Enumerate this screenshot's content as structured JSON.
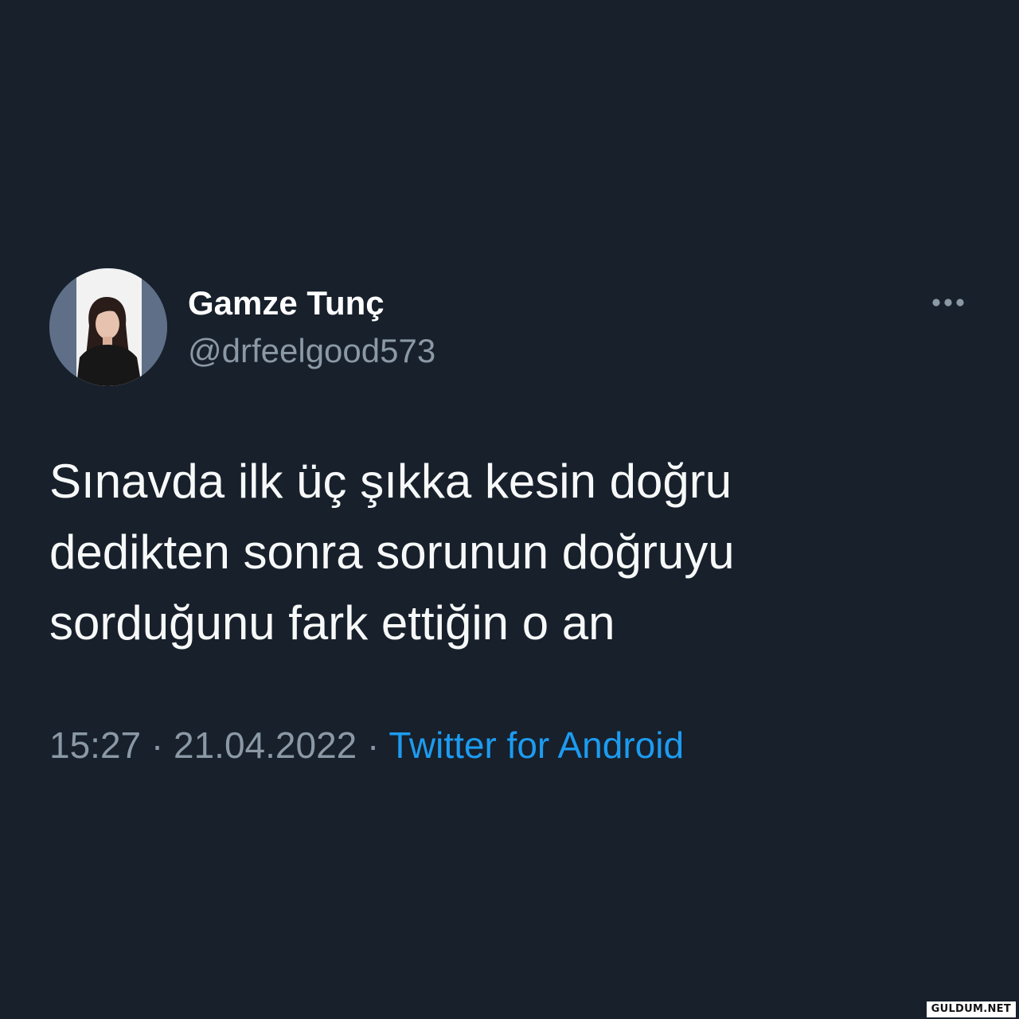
{
  "tweet": {
    "author": {
      "display_name": "Gamze Tunç",
      "handle": "@drfeelgood573",
      "avatar_icon": "profile-photo"
    },
    "more_icon": "more-options-icon",
    "text_lines": [
      "Sınavda ilk üç şıkka kesin doğru",
      "dedikten sonra sorunun doğruyu",
      "sorduğunu fark ettiğin o an"
    ],
    "time": "15:27",
    "separator": "·",
    "date": "21.04.2022",
    "source": "Twitter for Android"
  },
  "watermark": "GULDUM.NET",
  "colors": {
    "background": "#17202b",
    "text_primary": "#f7f9f9",
    "text_secondary": "#8b98a5",
    "link": "#1d9bf0"
  }
}
